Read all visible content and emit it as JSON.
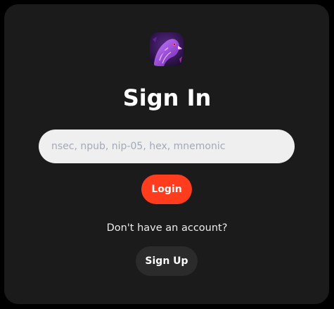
{
  "signin": {
    "avatar_icon": "purple-eagle-avatar-icon",
    "title": "Sign In",
    "input": {
      "placeholder": "nsec, npub, nip-05, hex, mnemonic",
      "value": ""
    },
    "login_label": "Login",
    "no_account_text": "Don't have an account?",
    "signup_label": "Sign Up"
  },
  "colors": {
    "page_background": "#000000",
    "card_background": "#1b1b1b",
    "input_background": "#efefef",
    "placeholder": "#a3a9b6",
    "login_button": "#ff3d1e",
    "signup_button": "#2b2b2b",
    "text": "#ffffff"
  }
}
